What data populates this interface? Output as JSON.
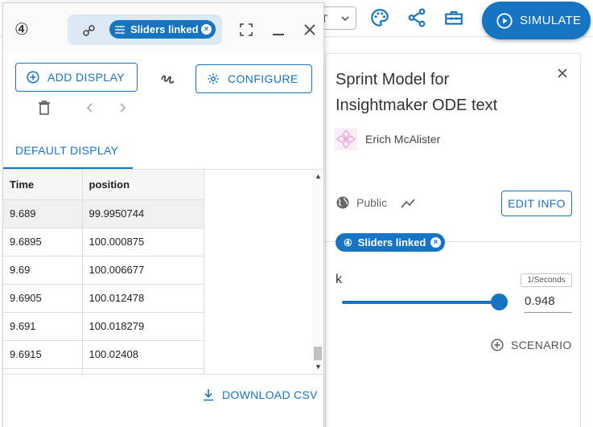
{
  "topbar": {
    "zoom_select_value": "T",
    "icons": [
      "palette-icon",
      "share-icon",
      "toolbox-icon"
    ],
    "simulate_label": "SIMULATE"
  },
  "info_panel": {
    "title": "Sprint Model for Insightmaker ODE text",
    "author": "Erich McAlister",
    "visibility": "Public",
    "edit_info_label": "EDIT INFO",
    "linked_chip_label": "Sliders linked",
    "linked_chip_number": "④",
    "parameter": {
      "name": "k",
      "unit": "1/Seconds",
      "value": "0.948",
      "slider_fraction": 1.0
    },
    "scenario_label": "SCENARIO"
  },
  "display_window": {
    "window_number": "④",
    "linked_chip_label": "Sliders linked",
    "add_display_label": "ADD DISPLAY",
    "configure_label": "CONFIGURE",
    "tab_label": "DEFAULT DISPLAY",
    "columns": [
      "Time",
      "position"
    ],
    "rows": [
      [
        "9.689",
        "99.9950744"
      ],
      [
        "9.6895",
        "100.000875"
      ],
      [
        "9.69",
        "100.006677"
      ],
      [
        "9.6905",
        "100.012478"
      ],
      [
        "9.691",
        "100.018279"
      ],
      [
        "9.6915",
        "100.02408"
      ]
    ],
    "download_label": "DOWNLOAD CSV"
  },
  "colors": {
    "accent": "#1674c2",
    "chip_group_bg": "#dce9f5"
  }
}
